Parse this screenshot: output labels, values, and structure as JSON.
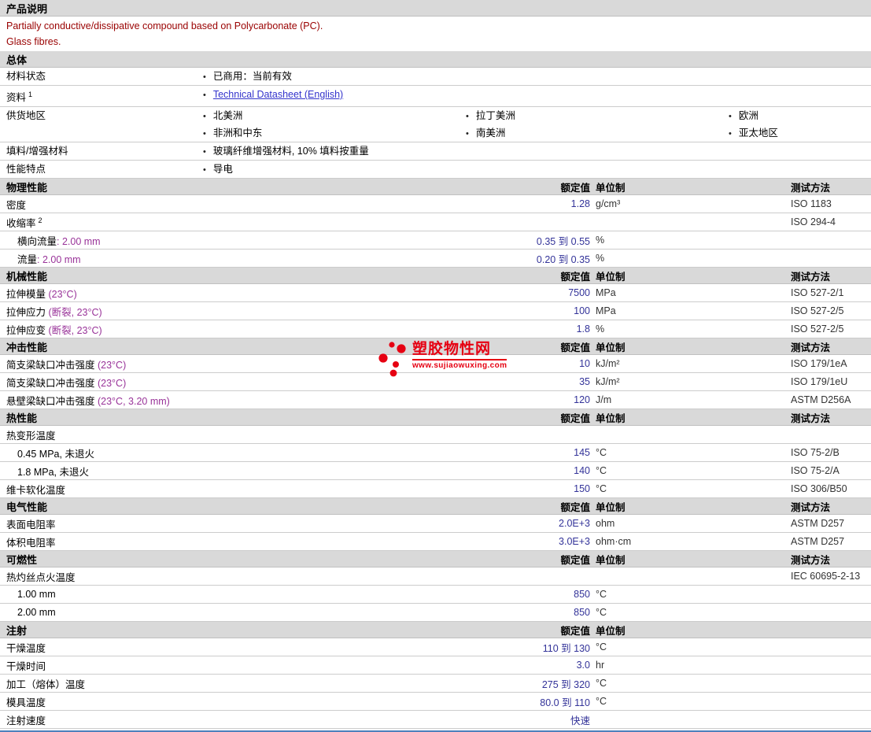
{
  "colors": {
    "section_bar_gray": "#d9d9d9",
    "description_red": "#990000",
    "value_blue": "#333399",
    "condition_purple": "#993399",
    "link_blue": "#3333cc",
    "watermark_red": "#e60012",
    "bottom_rule_blue": "#4f81bd"
  },
  "description": {
    "title": "产品说明",
    "lines": [
      "Partially conductive/dissipative compound based on Polycarbonate (PC).",
      "Glass fibres."
    ]
  },
  "general": {
    "title": "总体",
    "rows": [
      {
        "label": "材料状态",
        "columns": [
          [
            "已商用：当前有效"
          ]
        ]
      },
      {
        "label": "资料",
        "sup": "1",
        "link": "Technical Datasheet (English)"
      },
      {
        "label": "供货地区",
        "columns": [
          [
            "北美洲",
            "非洲和中东"
          ],
          [
            "拉丁美洲",
            "南美洲"
          ],
          [
            "欧洲",
            "亚太地区"
          ]
        ]
      },
      {
        "label": "填料/增强材料",
        "columns": [
          [
            "玻璃纤维增强材料, 10% 填料按重量"
          ]
        ]
      },
      {
        "label": "性能特点",
        "columns": [
          [
            "导电"
          ]
        ]
      }
    ]
  },
  "sections": [
    {
      "title": "物理性能",
      "cols": {
        "value": "额定值",
        "unit": "单位制",
        "method": "测试方法"
      },
      "rows": [
        {
          "label": "密度",
          "value": "1.28",
          "unit": "g/cm³",
          "method": "ISO 1183"
        },
        {
          "label": "收缩率",
          "sup": "2",
          "method": "ISO 294-4"
        },
        {
          "label": "横向流量",
          "cond": ": 2.00 mm",
          "indent": true,
          "value": "0.35 到 0.55",
          "unit": "%"
        },
        {
          "label": "流量",
          "cond": ": 2.00 mm",
          "indent": true,
          "value": "0.20 到 0.35",
          "unit": "%"
        }
      ]
    },
    {
      "title": "机械性能",
      "cols": {
        "value": "额定值",
        "unit": "单位制",
        "method": "测试方法"
      },
      "rows": [
        {
          "label": "拉伸模量",
          "cond": " (23°C)",
          "value": "7500",
          "unit": "MPa",
          "method": "ISO 527-2/1"
        },
        {
          "label": "拉伸应力",
          "cond": " (断裂, 23°C)",
          "value": "100",
          "unit": "MPa",
          "method": "ISO 527-2/5"
        },
        {
          "label": "拉伸应变",
          "cond": " (断裂, 23°C)",
          "value": "1.8",
          "unit": "%",
          "method": "ISO 527-2/5"
        }
      ]
    },
    {
      "title": "冲击性能",
      "cols": {
        "value": "额定值",
        "unit": "单位制",
        "method": "测试方法"
      },
      "rows": [
        {
          "label": "简支梁缺口冲击强度",
          "cond": " (23°C)",
          "value": "10",
          "unit": "kJ/m²",
          "method": "ISO 179/1eA"
        },
        {
          "label": "简支梁缺口冲击强度",
          "cond": " (23°C)",
          "value": "35",
          "unit": "kJ/m²",
          "method": "ISO 179/1eU"
        },
        {
          "label": "悬壁梁缺口冲击强度",
          "cond": " (23°C, 3.20 mm)",
          "value": "120",
          "unit": "J/m",
          "method": "ASTM D256A"
        }
      ]
    },
    {
      "title": "热性能",
      "cols": {
        "value": "额定值",
        "unit": "单位制",
        "method": "测试方法"
      },
      "rows": [
        {
          "label": "热变形温度"
        },
        {
          "label": "0.45 MPa, 未退火",
          "indent": true,
          "value": "145",
          "unit": "°C",
          "method": "ISO 75-2/B"
        },
        {
          "label": "1.8 MPa, 未退火",
          "indent": true,
          "value": "140",
          "unit": "°C",
          "method": "ISO 75-2/A"
        },
        {
          "label": "维卡软化温度",
          "value": "150",
          "unit": "°C",
          "method": "ISO 306/B50"
        }
      ]
    },
    {
      "title": "电气性能",
      "cols": {
        "value": "额定值",
        "unit": "单位制",
        "method": "测试方法"
      },
      "rows": [
        {
          "label": "表面电阻率",
          "value": "2.0E+3",
          "unit": "ohm",
          "method": "ASTM D257"
        },
        {
          "label": "体积电阻率",
          "value": "3.0E+3",
          "unit": "ohm·cm",
          "method": "ASTM D257"
        }
      ]
    },
    {
      "title": "可燃性",
      "cols": {
        "value": "额定值",
        "unit": "单位制",
        "method": "测试方法"
      },
      "rows": [
        {
          "label": "热灼丝点火温度",
          "method": "IEC 60695-2-13"
        },
        {
          "label": "1.00 mm",
          "indent": true,
          "value": "850",
          "unit": "°C"
        },
        {
          "label": "2.00 mm",
          "indent": true,
          "value": "850",
          "unit": "°C"
        }
      ]
    },
    {
      "title": "注射",
      "cols": {
        "value": "额定值",
        "unit": "单位制",
        "method": ""
      },
      "rows": [
        {
          "label": "干燥温度",
          "value": "110 到 130",
          "unit": "°C"
        },
        {
          "label": "干燥时间",
          "value": "3.0",
          "unit": "hr"
        },
        {
          "label": "加工（熔体）温度",
          "value": "275 到 320",
          "unit": "°C"
        },
        {
          "label": "模具温度",
          "value": "80.0 到 110",
          "unit": "°C"
        },
        {
          "label": "注射速度",
          "value": "快速"
        }
      ]
    }
  ],
  "watermark": {
    "site_name": "塑胶物性网",
    "site_url": "www.sujiaowuxing.com"
  }
}
